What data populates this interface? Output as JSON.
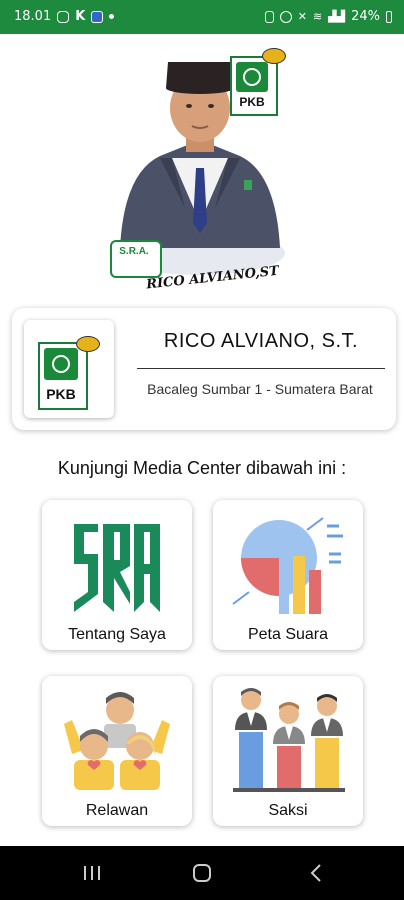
{
  "status_bar": {
    "time": "18.01",
    "notif_k": "K",
    "battery": "24%"
  },
  "hero": {
    "signature": "RICO ALVIANO,ST",
    "pkb_logo_text": "PKB",
    "sra_badge_text": "S.R.A."
  },
  "profile": {
    "name": "RICO ALVIANO, S.T.",
    "subtitle": "Bacaleg Sumbar 1 - Sumatera Barat",
    "logo_text": "PKB"
  },
  "section": {
    "title": "Kunjungi Media Center dibawah ini :"
  },
  "menu": {
    "items": [
      {
        "label": "Tentang Saya",
        "icon": "sra-logo-icon"
      },
      {
        "label": "Peta Suara",
        "icon": "chart-icon"
      },
      {
        "label": "Relawan",
        "icon": "volunteers-icon"
      },
      {
        "label": "Saksi",
        "icon": "witness-podium-icon"
      }
    ]
  },
  "colors": {
    "status_green": "#1d8a3e",
    "sra_green": "#1a8a5a",
    "nav_black": "#000000"
  }
}
